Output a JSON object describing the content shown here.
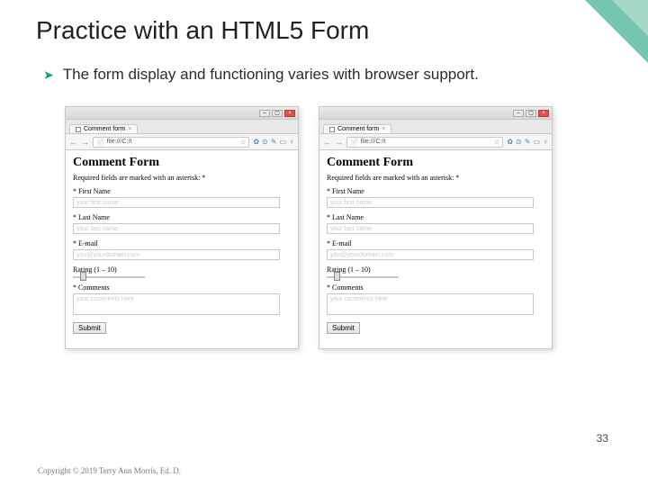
{
  "slide": {
    "title": "Practice with an HTML5 Form",
    "bullet": "The form display and functioning varies with browser support.",
    "page_number": "33",
    "copyright": "Copyright © 2019 Terry Ann Morris, Ed. D."
  },
  "browser": {
    "tab_title": "Comment form",
    "url_text": "file:///C:/t",
    "form_heading": "Comment Form",
    "required_note": "Required fields are marked with an asterisk: *",
    "labels": {
      "first": "* First Name",
      "last": "* Last Name",
      "email": "* E-mail",
      "rating": "Rating (1 – 10)",
      "comments": "* Comments"
    },
    "placeholders": {
      "first": "your first name",
      "last": "your last name",
      "email": "you@yourdomain.com",
      "comments": "your comments here"
    },
    "submit": "Submit"
  }
}
